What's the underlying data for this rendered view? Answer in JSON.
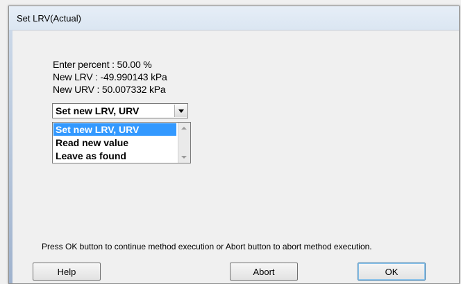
{
  "window": {
    "title": "Set LRV(Actual)"
  },
  "info": {
    "percent_line": "Enter percent : 50.00 %",
    "lrv_line": "New LRV : -49.990143 kPa",
    "urv_line": "New URV : 50.007332 kPa"
  },
  "combo": {
    "selected": "Set new LRV, URV",
    "options": [
      "Set new LRV, URV",
      "Read new value",
      "Leave as found"
    ]
  },
  "message": "Press OK button to continue method execution or Abort button to abort method execution.",
  "buttons": {
    "help": "Help",
    "abort": "Abort",
    "ok": "OK"
  },
  "colors": {
    "selection": "#3399ff",
    "title_bar": "#dbe6f2"
  },
  "icons": {
    "combo_arrow": "chevron-down-icon",
    "scroll_up": "scroll-up-icon",
    "scroll_down": "scroll-down-icon"
  }
}
